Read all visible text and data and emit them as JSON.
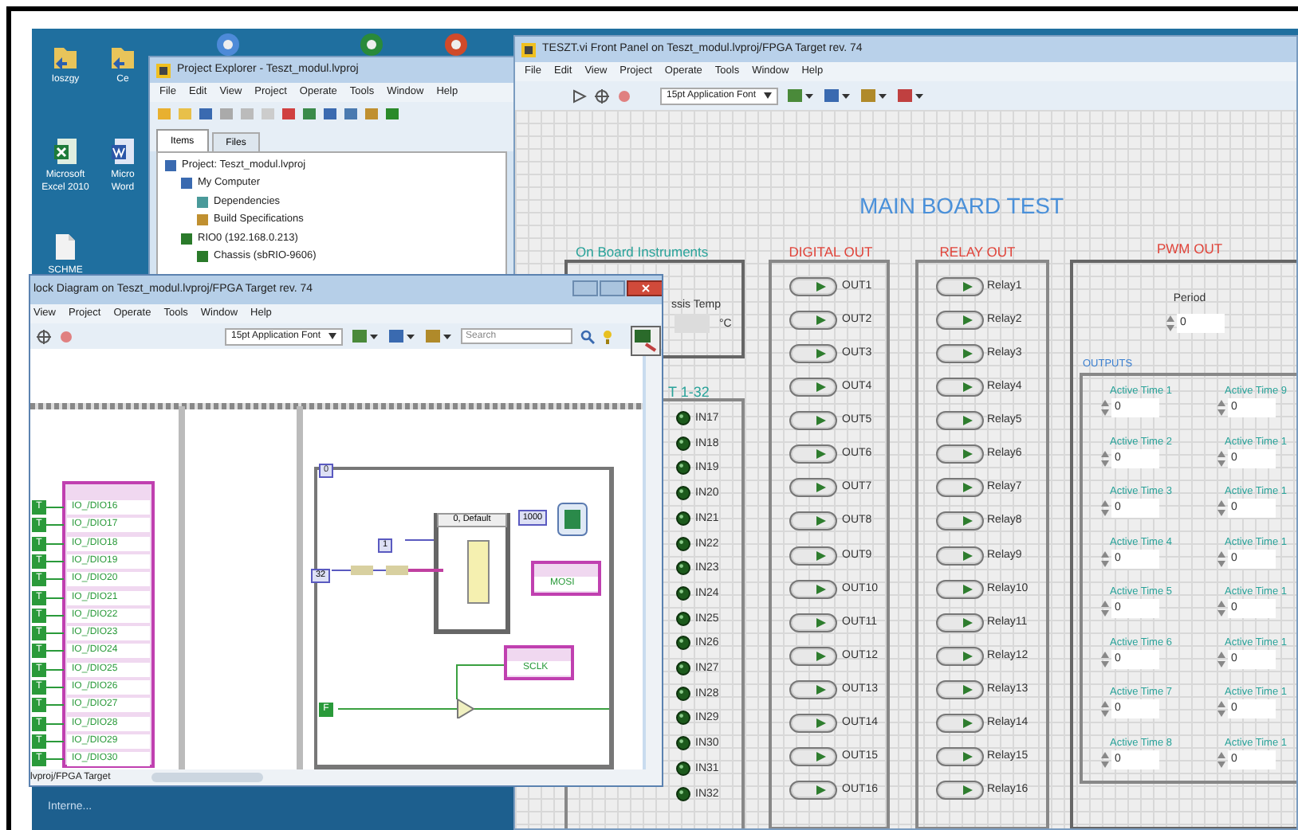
{
  "desktop": {
    "icons": [
      {
        "label": "Ioszgy"
      },
      {
        "label": "Ce"
      },
      {
        "label": "Microsoft Excel 2010"
      },
      {
        "label": "Micro Word"
      },
      {
        "label": "SCHME"
      }
    ],
    "taskbar": {
      "text": "Interne..."
    }
  },
  "front_panel": {
    "title": "TESZT.vi Front Panel on Teszt_modul.lvproj/FPGA Target rev. 74",
    "menu": [
      "File",
      "Edit",
      "View",
      "Project",
      "Operate",
      "Tools",
      "Window",
      "Help"
    ],
    "font_selector": "15pt Application Font",
    "heading": "MAIN BOARD TEST",
    "instruments": {
      "label": "On Board Instruments",
      "temp_label": "ssis Temp",
      "unit": "°C"
    },
    "inputs": {
      "label": "T 1-32",
      "leds": [
        {
          "label": "IN17",
          "on": false
        },
        {
          "label": "IN18",
          "on": false
        },
        {
          "label": "IN19",
          "on": false
        },
        {
          "label": "IN20",
          "on": false
        },
        {
          "label": "IN21",
          "on": false
        },
        {
          "label": "IN22",
          "on": false
        },
        {
          "label": "IN23",
          "on": false
        },
        {
          "label": "IN24",
          "on": false
        },
        {
          "label": "IN25",
          "on": false
        },
        {
          "label": "IN26",
          "on": false
        },
        {
          "label": "IN27",
          "on": false
        },
        {
          "label": "IN28",
          "on": false
        },
        {
          "label": "IN29",
          "on": false
        },
        {
          "label": "IN30",
          "on": false
        },
        {
          "label": "IN31",
          "on": false
        },
        {
          "label": "IN32",
          "on": false
        }
      ]
    },
    "digital_out": {
      "label": "DIGITAL OUT",
      "switches": [
        {
          "label": "OUT1",
          "on": false
        },
        {
          "label": "OUT2",
          "on": false
        },
        {
          "label": "OUT3",
          "on": false
        },
        {
          "label": "OUT4",
          "on": false
        },
        {
          "label": "OUT5",
          "on": false
        },
        {
          "label": "OUT6",
          "on": false
        },
        {
          "label": "OUT7",
          "on": false
        },
        {
          "label": "OUT8",
          "on": false
        },
        {
          "label": "OUT9",
          "on": false
        },
        {
          "label": "OUT10",
          "on": false
        },
        {
          "label": "OUT11",
          "on": false
        },
        {
          "label": "OUT12",
          "on": false
        },
        {
          "label": "OUT13",
          "on": false
        },
        {
          "label": "OUT14",
          "on": false
        },
        {
          "label": "OUT15",
          "on": false
        },
        {
          "label": "OUT16",
          "on": false
        }
      ]
    },
    "relay_out": {
      "label": "RELAY OUT",
      "switches": [
        {
          "label": "Relay1",
          "on": false
        },
        {
          "label": "Relay2",
          "on": false
        },
        {
          "label": "Relay3",
          "on": false
        },
        {
          "label": "Relay4",
          "on": false
        },
        {
          "label": "Relay5",
          "on": false
        },
        {
          "label": "Relay6",
          "on": false
        },
        {
          "label": "Relay7",
          "on": false
        },
        {
          "label": "Relay8",
          "on": false
        },
        {
          "label": "Relay9",
          "on": false
        },
        {
          "label": "Relay10",
          "on": false
        },
        {
          "label": "Relay11",
          "on": false
        },
        {
          "label": "Relay12",
          "on": false
        },
        {
          "label": "Relay13",
          "on": false
        },
        {
          "label": "Relay14",
          "on": false
        },
        {
          "label": "Relay15",
          "on": false
        },
        {
          "label": "Relay16",
          "on": false
        }
      ]
    },
    "pwm_out": {
      "label": "PWM OUT",
      "period": {
        "label": "Period",
        "value": "0"
      },
      "outputs_label": "OUTPUTS",
      "fields": [
        {
          "label": "Active Time 1",
          "value": "0"
        },
        {
          "label": "Active Time 9",
          "value": "0"
        },
        {
          "label": "Active Time 2",
          "value": "0"
        },
        {
          "label": "Active Time 1",
          "value": "0"
        },
        {
          "label": "Active Time 3",
          "value": "0"
        },
        {
          "label": "Active Time 1",
          "value": "0"
        },
        {
          "label": "Active Time 4",
          "value": "0"
        },
        {
          "label": "Active Time 1",
          "value": "0"
        },
        {
          "label": "Active Time 5",
          "value": "0"
        },
        {
          "label": "Active Time 1",
          "value": "0"
        },
        {
          "label": "Active Time 6",
          "value": "0"
        },
        {
          "label": "Active Time 1",
          "value": "0"
        },
        {
          "label": "Active Time 7",
          "value": "0"
        },
        {
          "label": "Active Time 1",
          "value": "0"
        },
        {
          "label": "Active Time 8",
          "value": "0"
        },
        {
          "label": "Active Time 1",
          "value": "0"
        }
      ]
    }
  },
  "project_explorer": {
    "title": "Project Explorer - Teszt_modul.lvproj",
    "menu": [
      "File",
      "Edit",
      "View",
      "Project",
      "Operate",
      "Tools",
      "Window",
      "Help"
    ],
    "tabs": [
      {
        "label": "Items",
        "selected": true
      },
      {
        "label": "Files",
        "selected": false
      }
    ],
    "tree": [
      {
        "label": "Project: Teszt_modul.lvproj",
        "children": [
          {
            "label": "My Computer",
            "children": [
              {
                "label": "Dependencies"
              },
              {
                "label": "Build Specifications"
              }
            ]
          },
          {
            "label": "RIO0 (192.168.0.213)",
            "children": [
              {
                "label": "Chassis (sbRIO-9606)"
              }
            ]
          }
        ]
      }
    ]
  },
  "block_diagram": {
    "title": "lock Diagram on Teszt_modul.lvproj/FPGA Target rev. 74",
    "menu": [
      "View",
      "Project",
      "Operate",
      "Tools",
      "Window",
      "Help"
    ],
    "font_selector": "15pt Application Font",
    "search_placeholder": "Search",
    "io_nodes": [
      {
        "constant": "T",
        "name": "IO_/DIO16"
      },
      {
        "constant": "T",
        "name": "IO_/DIO17"
      },
      {
        "constant": "T",
        "name": "IO_/DIO18"
      },
      {
        "constant": "T",
        "name": "IO_/DIO19"
      },
      {
        "constant": "T",
        "name": "IO_/DIO20"
      },
      {
        "constant": "T",
        "name": "IO_/DIO21"
      },
      {
        "constant": "T",
        "name": "IO_/DIO22"
      },
      {
        "constant": "T",
        "name": "IO_/DIO23"
      },
      {
        "constant": "T",
        "name": "IO_/DIO24"
      },
      {
        "constant": "T",
        "name": "IO_/DIO25"
      },
      {
        "constant": "T",
        "name": "IO_/DIO26"
      },
      {
        "constant": "T",
        "name": "IO_/DIO27"
      },
      {
        "constant": "T",
        "name": "IO_/DIO28"
      },
      {
        "constant": "T",
        "name": "IO_/DIO29"
      },
      {
        "constant": "T",
        "name": "IO_/DIO30"
      }
    ],
    "case_selector": "0, Default",
    "wait_constant": "1000",
    "loop_constant": "0",
    "index_constant": "1",
    "count_constant": "32",
    "bool_constant": "F",
    "fpga_nodes": [
      "MOSI",
      "SCLK"
    ],
    "status": "lvproj/FPGA Target"
  }
}
